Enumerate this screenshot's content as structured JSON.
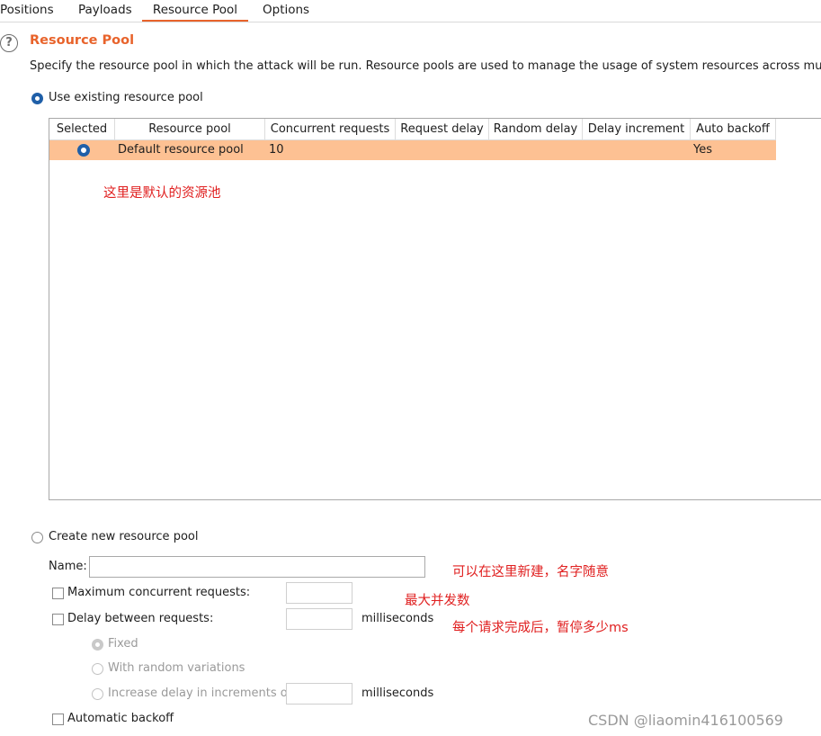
{
  "tabs": [
    {
      "label": "Positions",
      "active": false
    },
    {
      "label": "Payloads",
      "active": false
    },
    {
      "label": "Resource Pool",
      "active": true
    },
    {
      "label": "Options",
      "active": false
    }
  ],
  "section": {
    "help_icon": "question-circle-icon",
    "title": "Resource Pool",
    "description": "Specify the resource pool in which the attack will be run. Resource pools are used to manage the usage of system resources across multiple tas"
  },
  "use_existing": {
    "label": "Use existing resource pool",
    "selected": true
  },
  "table": {
    "columns": [
      "Selected",
      "Resource pool",
      "Concurrent requests",
      "Request delay",
      "Random delay",
      "Delay increment",
      "Auto backoff"
    ],
    "rows": [
      {
        "selected": true,
        "resource_pool": "Default resource pool",
        "concurrent_requests": "10",
        "request_delay": "",
        "random_delay": "",
        "delay_increment": "",
        "auto_backoff": "Yes"
      }
    ]
  },
  "create_new": {
    "label": "Create new resource pool",
    "selected": false,
    "name_label": "Name:",
    "name_value": "",
    "max_concurrent_label": "Maximum concurrent requests:",
    "max_concurrent_value": "",
    "delay_label": "Delay between requests:",
    "delay_value": "",
    "delay_unit": "milliseconds",
    "fixed_label": "Fixed",
    "random_label": "With random variations",
    "increase_label": "Increase delay in increments of",
    "increase_value": "",
    "increase_unit": "milliseconds",
    "auto_backoff_label": "Automatic backoff"
  },
  "annotations": {
    "default_pool": "这里是默认的资源池",
    "create_here": "可以在这里新建，名字随意",
    "max_concurrency": "最大并发数",
    "pause_after": "每个请求完成后，暂停多少ms"
  },
  "watermark": "CSDN @liaomin416100569",
  "colors": {
    "accent": "#e8632b",
    "selected_row": "#fdc193",
    "radio_selected": "#1f5fa8",
    "annotation": "#e02020"
  }
}
